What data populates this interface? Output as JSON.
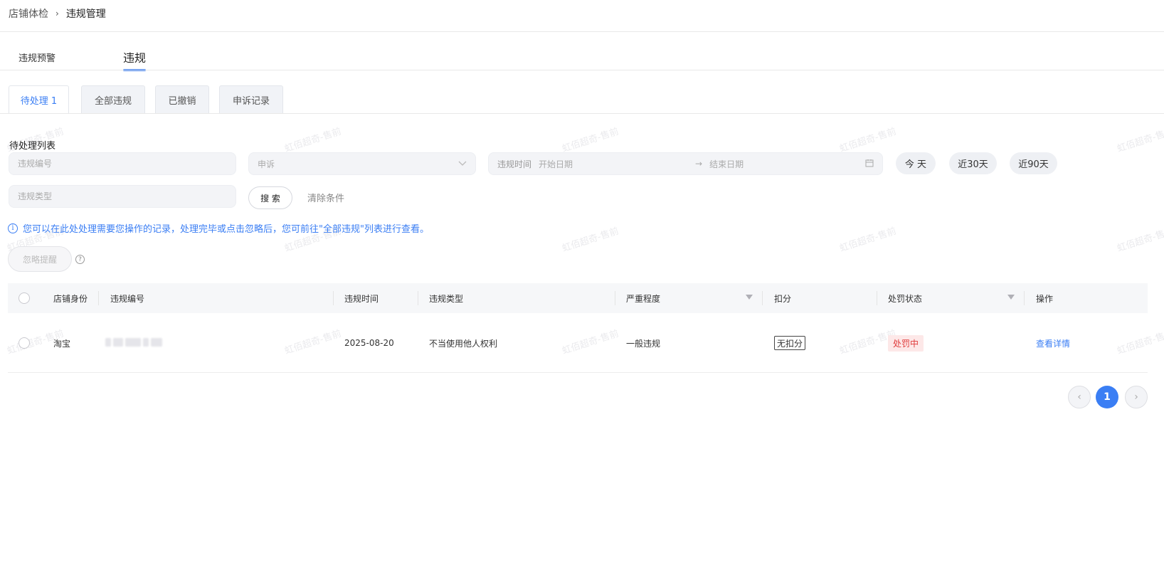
{
  "breadcrumb": {
    "parent": "店铺体检",
    "separator": "›",
    "current": "违规管理"
  },
  "main_tabs": [
    "违规预警",
    "违规"
  ],
  "sub_tabs": [
    "待处理 1",
    "全部违规",
    "已撤销",
    "申诉记录"
  ],
  "watermark_text": "虹佰超奇-售前",
  "section_title": "待处理列表",
  "filters": {
    "violation_id_placeholder": "违规编号",
    "appeal_placeholder": "申诉",
    "time_label": "违规时间",
    "start_placeholder": "开始日期",
    "range_arrow": "→",
    "end_placeholder": "结束日期",
    "violation_type_placeholder": "违规类型",
    "quick_ranges": [
      "今 天",
      "近30天",
      "近90天"
    ],
    "search_label": "搜 索",
    "clear_label": "清除条件"
  },
  "info_text": "您可以在此处处理需要您操作的记录，处理完毕或点击忽略后，您可前往\"全部违规\"列表进行查看。",
  "ignore_label": "忽略提醒",
  "table": {
    "headers": {
      "shop_identity": "店铺身份",
      "violation_id": "违规编号",
      "violation_time": "违规时间",
      "violation_type": "违规类型",
      "severity": "严重程度",
      "deduction": "扣分",
      "penalty_status": "处罚状态",
      "action": "操作"
    },
    "rows": [
      {
        "shop_identity": "淘宝",
        "violation_time": "2025-08-20",
        "violation_type": "不当使用他人权利",
        "severity": "一般违规",
        "deduction": "无扣分",
        "penalty_status": "处罚中",
        "action": "查看详情"
      }
    ]
  },
  "pagination": {
    "current_page": "1",
    "prev": "‹",
    "next": "›"
  },
  "colors": {
    "accent": "#3a7ef4",
    "status_red": "#e03b3b",
    "status_red_bg": "#fde8e8"
  }
}
